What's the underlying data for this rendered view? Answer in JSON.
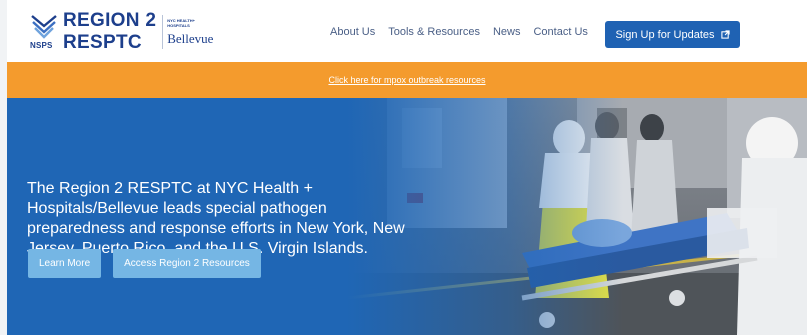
{
  "header": {
    "logo": {
      "nsps": "NSPS",
      "title_line1": "REGION 2",
      "title_line2": "RESPTC",
      "hospital_mark": "NYC HEALTH+ HOSPITALS",
      "hospital_name": "Bellevue"
    },
    "nav": [
      {
        "label": "About Us"
      },
      {
        "label": "Tools & Resources"
      },
      {
        "label": "News"
      },
      {
        "label": "Contact Us"
      }
    ],
    "cta_label": "Sign Up for Updates"
  },
  "alert": {
    "link_text": "Click here for mpox outbreak resources"
  },
  "hero": {
    "text": "The Region 2 RESPTC at NYC Health + Hospitals/Bellevue leads special pathogen preparedness and response efforts in New York, New Jersey, Puerto Rico, and the U.S. Virgin Islands.",
    "buttons": [
      {
        "label": "Learn More"
      },
      {
        "label": "Access Region 2 Resources"
      }
    ]
  },
  "colors": {
    "brand_blue": "#1d3f8c",
    "cta_blue": "#1f62b3",
    "alert_orange": "#f49b2d",
    "hero_blue": "#1f66b5",
    "hero_button": "#75b6e4"
  },
  "icons": {
    "cta": "external-link-icon"
  }
}
